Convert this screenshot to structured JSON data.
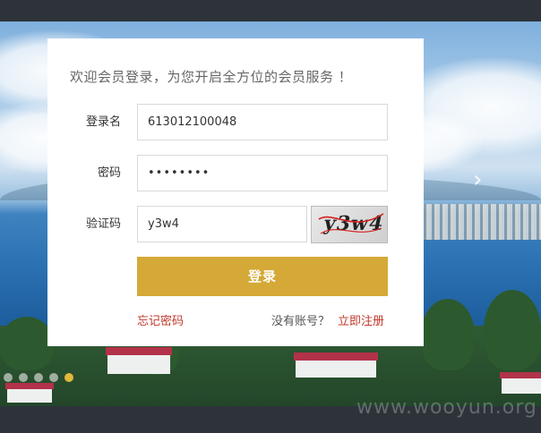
{
  "welcome_text": "欢迎会员登录，为您开启全方位的会员服务 ！",
  "form": {
    "username_label": "登录名",
    "username_value": "613012100048",
    "password_label": "密码",
    "password_value": "••••••••",
    "captcha_label": "验证码",
    "captcha_value": "y3w4",
    "captcha_image_text": "y3w4",
    "login_button": "登录",
    "forgot_link": "忘记密码",
    "no_account_text": "没有账号？",
    "register_link": "立即注册"
  },
  "carousel": {
    "next_arrow": "›",
    "dot_count": 5,
    "active_dot": 5
  },
  "watermark": "www.wooyun.org",
  "colors": {
    "button": "#d4a937",
    "link": "#c0392b",
    "active_dot": "#e0b93a"
  }
}
